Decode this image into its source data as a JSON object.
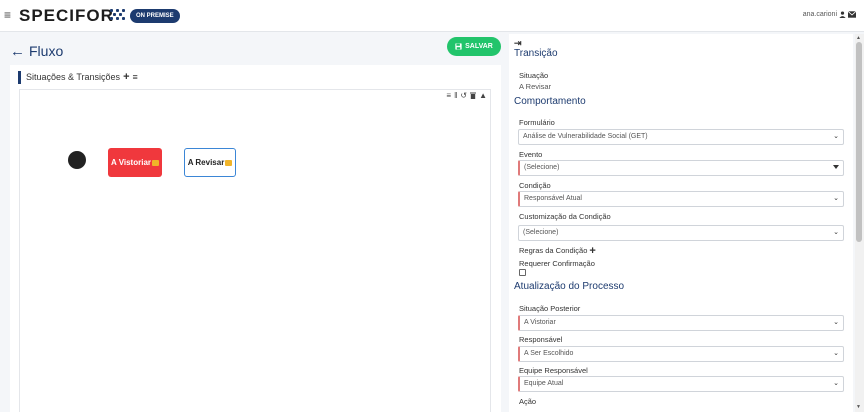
{
  "header": {
    "menu_icon": "hamburger-icon",
    "brand": "SPECIFOR",
    "badge": "ON PREMISE",
    "username": "ana.carioni",
    "user_icon": "user-icon",
    "mail_icon": "envelope-icon"
  },
  "flow": {
    "back_icon": "arrow-left-icon",
    "title": "Fluxo",
    "save_label": "SALVAR",
    "save_icon": "floppy-disk-icon",
    "accent": "#22c46b"
  },
  "canvas_card": {
    "title": "Situações & Transições",
    "add_icon": "plus-icon",
    "menu_icon": "list-icon",
    "tools": [
      "align-icon",
      "pause-icon",
      "undo-icon",
      "trash-icon",
      "collapse-up-icon"
    ]
  },
  "diagram": {
    "nodes": [
      {
        "label": "A Vistoriar",
        "color": "#f0383d"
      },
      {
        "label": "A Revisar",
        "color": "#ffffff",
        "border": "#3b86d6"
      }
    ]
  },
  "panel": {
    "collapse_icon": "arrow-right-to-bar-icon",
    "transicao_title": "Transição",
    "situacao_label": "Situação",
    "situacao_value": "A Revisar",
    "comportamento_title": "Comportamento",
    "formulario_label": "Formulário",
    "formulario_value": "Análise de Vulnerabilidade Social (GET)",
    "evento_label": "Evento",
    "evento_value": "(Selecione)",
    "condicao_label": "Condição",
    "condicao_value": "Responsável Atual",
    "customizacao_label": "Customização da Condição",
    "customizacao_value": "(Selecione)",
    "regras_label": "Regras da Condição",
    "regras_icon": "plus-icon",
    "requerer_label": "Requerer Confirmação",
    "requerer_checked": false,
    "atualizacao_title": "Atualização do Processo",
    "situacao_posterior_label": "Situação Posterior",
    "situacao_posterior_value": "A Vistoriar",
    "responsavel_label": "Responsável",
    "responsavel_value": "A Ser Escolhido",
    "equipe_label": "Equipe Responsável",
    "equipe_value": "Equipe Atual",
    "acao_label": "Ação"
  }
}
